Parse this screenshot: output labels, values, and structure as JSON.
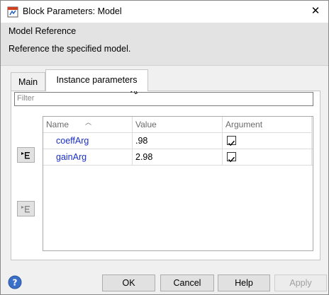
{
  "window": {
    "title": "Block Parameters: Model",
    "close_glyph": "✕",
    "app_icon": "simulink-block-icon"
  },
  "group": {
    "title": "Model Reference",
    "description": "Reference the specified model."
  },
  "tabs": [
    {
      "label": "Main",
      "selected": false
    },
    {
      "label": "Instance parameters",
      "selected": true
    }
  ],
  "filter": {
    "placeholder": "Filter",
    "value": ""
  },
  "table": {
    "columns": [
      "Name",
      "Value",
      "Argument"
    ],
    "sort_column": "Name",
    "rows": [
      {
        "name": "coeffArg",
        "value": ".98",
        "argument": true
      },
      {
        "name": "gainArg",
        "value": "2.98",
        "argument": true
      }
    ]
  },
  "side_buttons": [
    {
      "icon": "promote-parameter-icon",
      "enabled": true
    },
    {
      "icon": "demote-parameter-icon",
      "enabled": false
    }
  ],
  "footer": {
    "help_icon": "help-icon",
    "ok_label": "OK",
    "cancel_label": "Cancel",
    "help_label": "Help",
    "apply_label": "Apply",
    "apply_enabled": false
  },
  "colors": {
    "name_link": "#1a2ec8",
    "header_band": "#e3e3e3",
    "dialog_bg": "#f0f0f0"
  }
}
